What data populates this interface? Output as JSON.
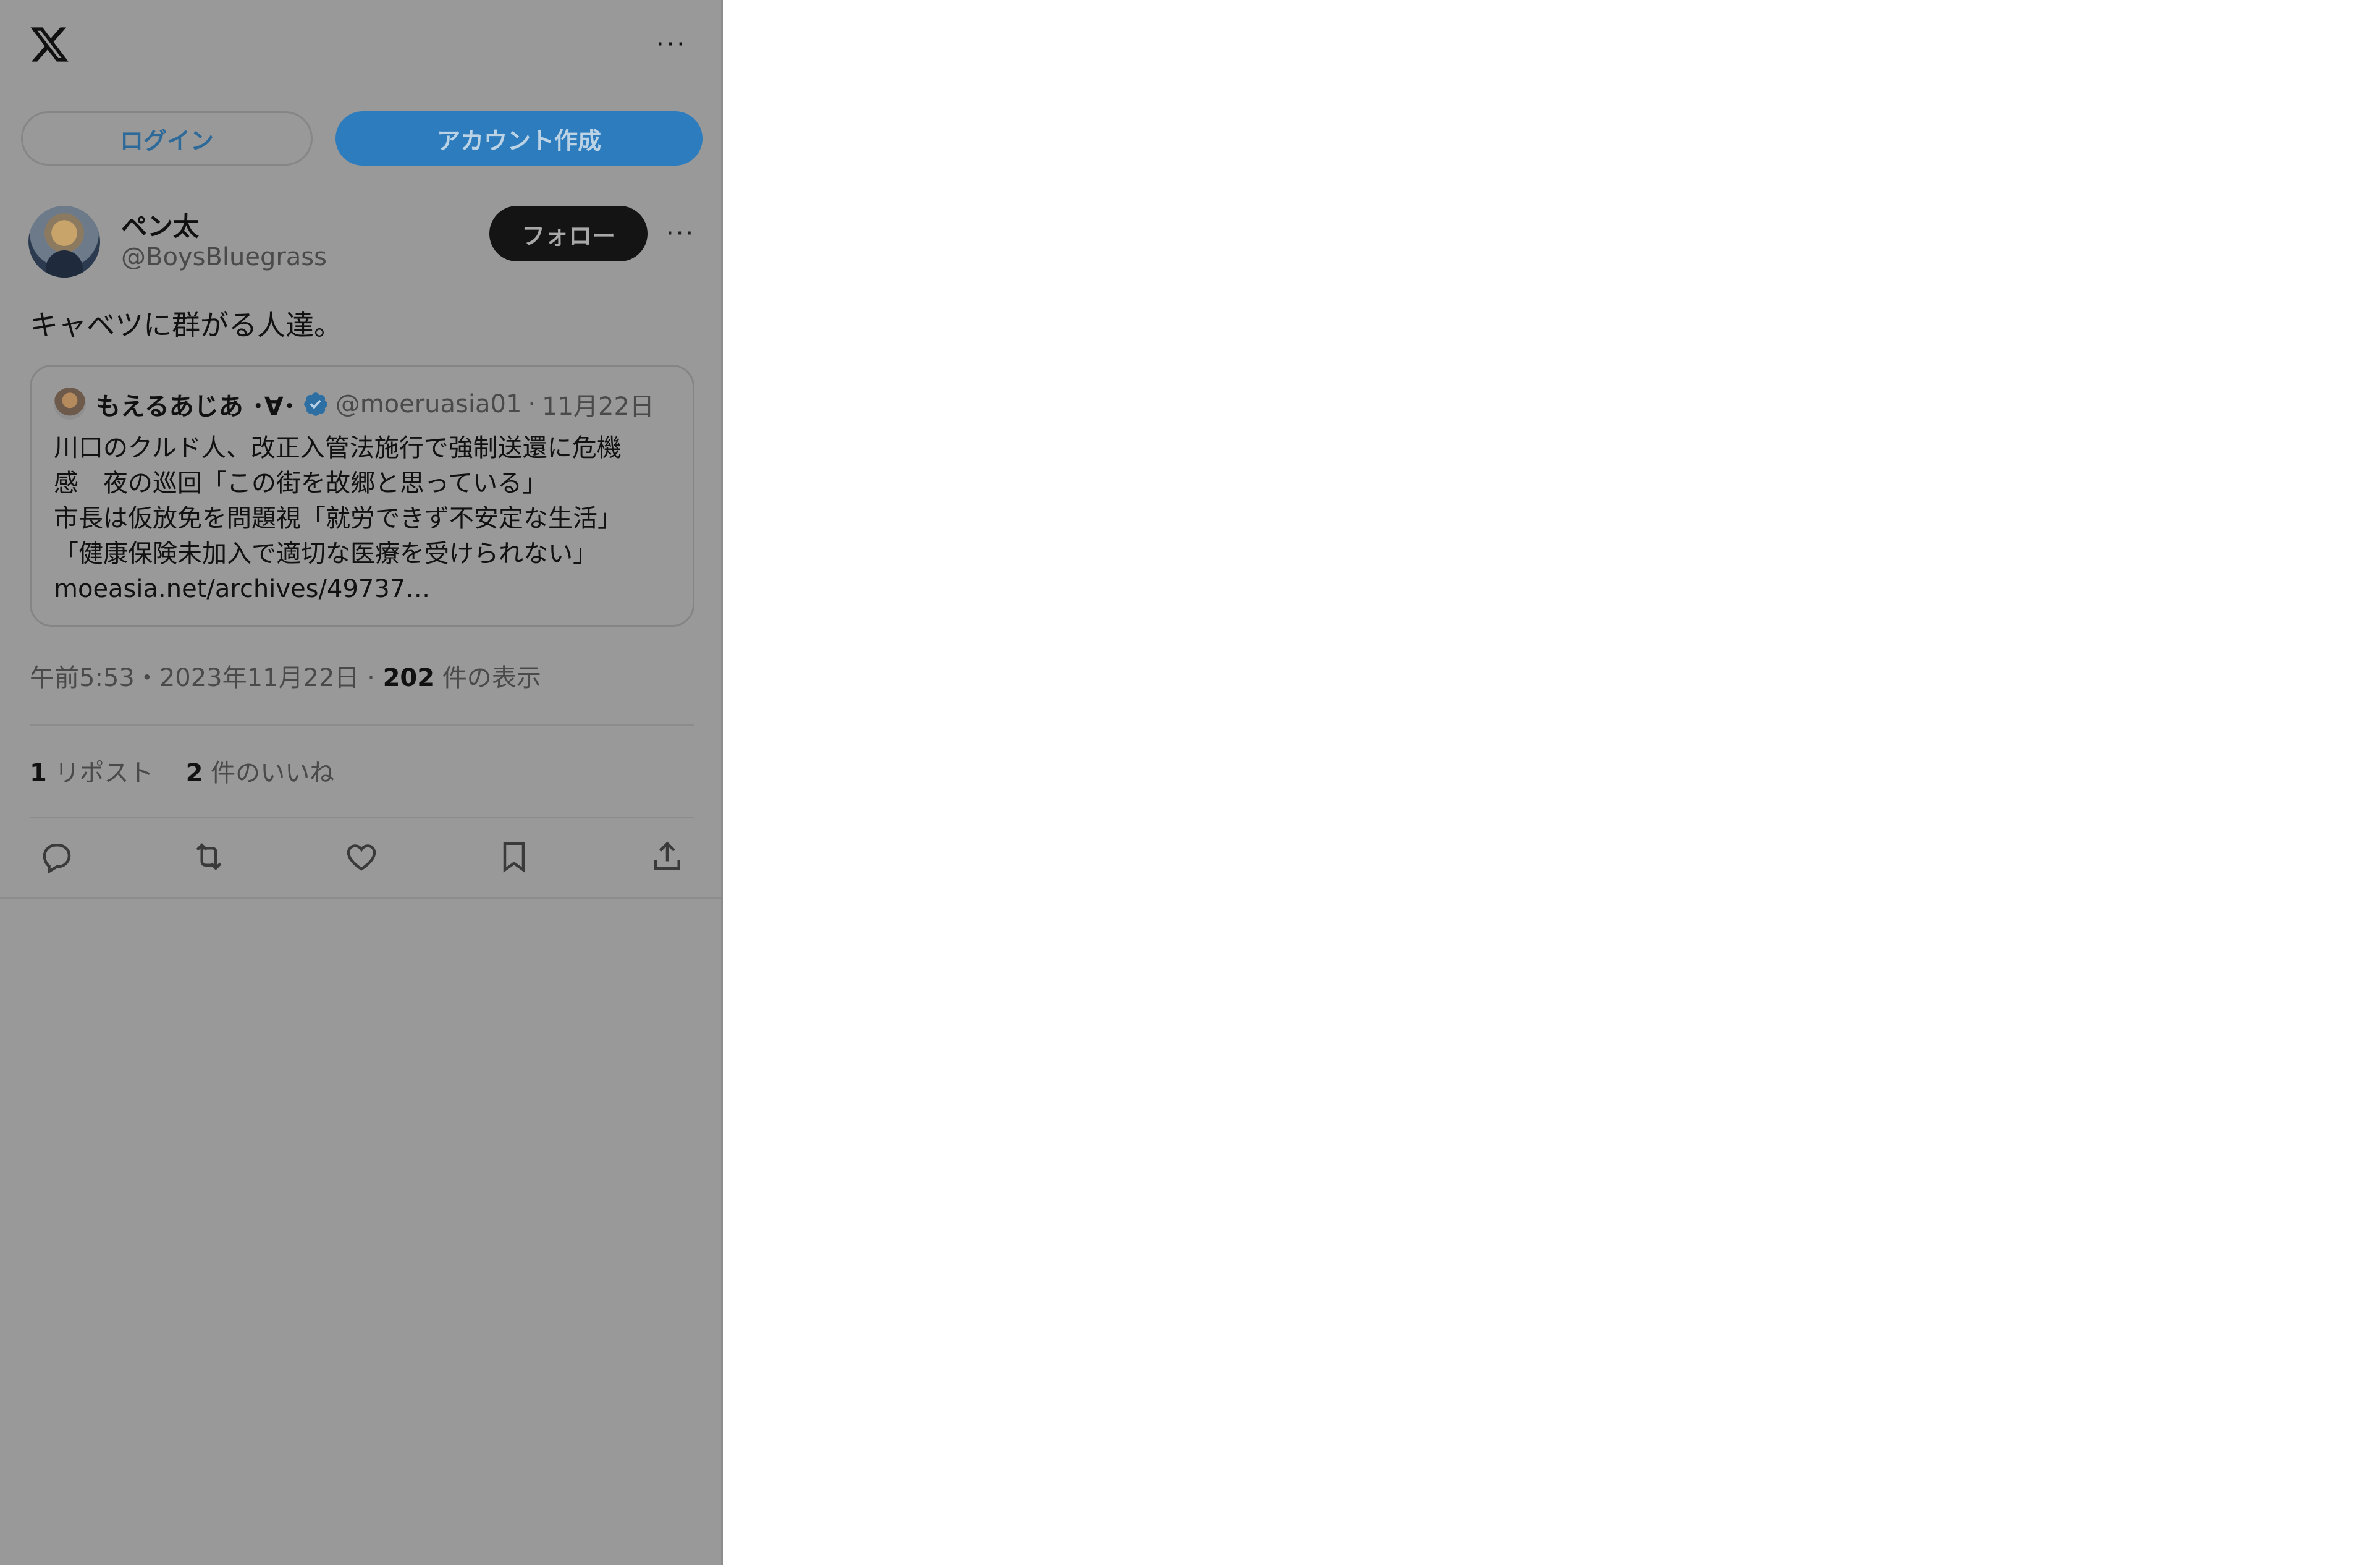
{
  "header": {
    "logo_icon": "x-logo-icon",
    "more_icon": "more-horizontal-icon",
    "more_glyph": "···"
  },
  "auth": {
    "login_label": "ログイン",
    "signup_label": "アカウント作成"
  },
  "post": {
    "author_name": "ペン太 ",
    "author_handle": "@BoysBluegrass",
    "follow_label": "フォロー",
    "more_glyph": "···",
    "text": "キャベツに群がる人達。",
    "quote": {
      "author_name": "もえるあじあ ･∀･",
      "verified_icon": "verified-badge-icon",
      "author_handle": "@moeruasia01",
      "separator": "·",
      "date": "11月22日",
      "lines": [
        "川口のクルド人、改正入管法施行で強制送還に危機",
        "感　夜の巡回「この街を故郷と思っている」",
        "市長は仮放免を問題視「就労できず不安定な生活」",
        "「健康保険未加入で適切な医療を受けられない」",
        "moeasia.net/archives/49737…"
      ]
    },
    "meta": {
      "time_date": "午前5:53・2023年11月22日",
      "separator": "·",
      "views_count": "202",
      "views_label": "件の表示"
    },
    "stats": {
      "reposts_count": "1",
      "reposts_label": "リポスト",
      "likes_count": "2",
      "likes_label": "件のいいね"
    },
    "actions": [
      "reply-icon",
      "repost-icon",
      "like-icon",
      "bookmark-icon",
      "share-icon"
    ]
  },
  "colors": {
    "overlay": "#999999",
    "accent": "#2d7cbd",
    "follow_bg": "#141414"
  }
}
